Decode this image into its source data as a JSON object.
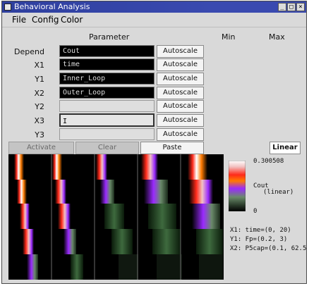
{
  "window": {
    "title": "Behavioral Analysis",
    "controls": [
      "_",
      "□",
      "×"
    ]
  },
  "menu": [
    "File",
    "Config",
    "Color"
  ],
  "headers": {
    "parameter": "Parameter",
    "min": "Min",
    "max": "Max"
  },
  "rows": [
    {
      "label": "Depend",
      "value": "Cout",
      "style": "dark"
    },
    {
      "label": "X1",
      "value": "time",
      "style": "dark"
    },
    {
      "label": "Y1",
      "value": "Inner_Loop",
      "style": "dark"
    },
    {
      "label": "X2",
      "value": "Outer_Loop",
      "style": "dark"
    },
    {
      "label": "Y2",
      "value": "",
      "style": "light"
    },
    {
      "label": "X3",
      "value": "",
      "style": "active"
    },
    {
      "label": "Y3",
      "value": "",
      "style": "light"
    }
  ],
  "autoscale_label": "Autoscale",
  "actions": {
    "activate": "Activate",
    "clear": "Clear",
    "paste": "Paste",
    "linear": "Linear"
  },
  "legend": {
    "max": "0.300508",
    "var": "Cout",
    "scale": "(linear)",
    "min": "0",
    "colors": [
      "#ffffff",
      "#f2c2c2",
      "#ff2a1a",
      "#ff7a00",
      "#9a2aff",
      "#6a8a6a",
      "#2a3a2a",
      "#000000"
    ]
  },
  "axes_info": [
    "X1: time=(0, 20)",
    "Y1: Fp=(0.2, 3)",
    "X2: P5cap=(0.1, 62.5"
  ]
}
